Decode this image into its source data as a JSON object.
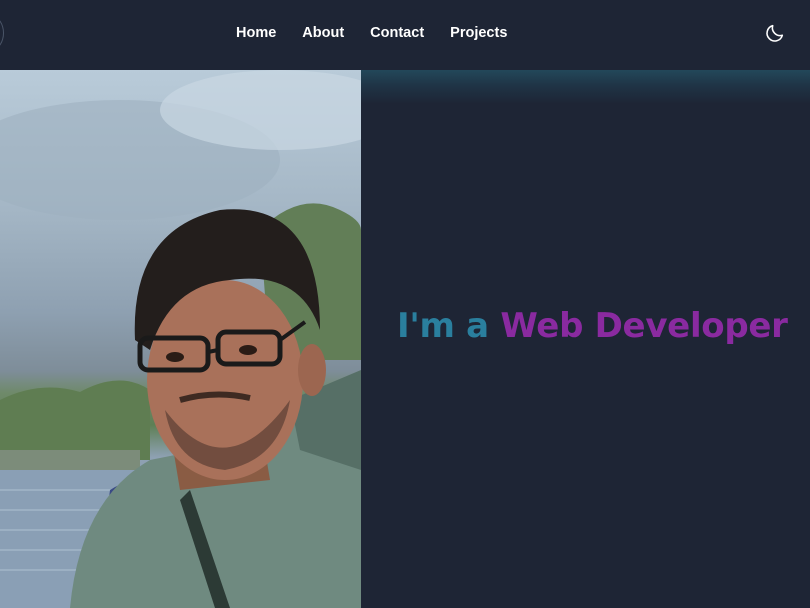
{
  "nav": {
    "items": [
      {
        "label": "Home"
      },
      {
        "label": "About"
      },
      {
        "label": "Contact"
      },
      {
        "label": "Projects"
      }
    ],
    "theme_toggle_icon": "moon-icon"
  },
  "hero": {
    "photo_icon": "profile-photo",
    "prefix": "I'm a ",
    "role": "Web Developer",
    "colors": {
      "prefix": "#2a7f9e",
      "role": "#8a2aa0",
      "background": "#1e2535"
    }
  }
}
